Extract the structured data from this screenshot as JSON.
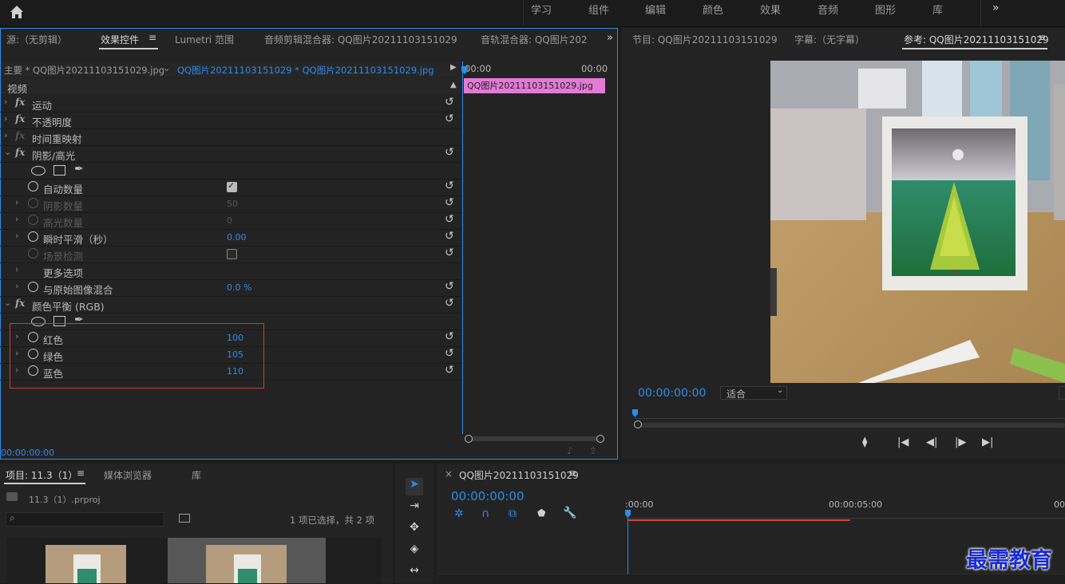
{
  "workspaces": [
    "学习",
    "组件",
    "编辑",
    "颜色",
    "效果",
    "音频",
    "图形",
    "库"
  ],
  "effect_panel": {
    "tabs": [
      "源:（无剪辑）",
      "效果控件",
      "Lumetri 范围",
      "音频剪辑混合器: QQ图片20211103151029",
      "音轨混合器: QQ图片202"
    ],
    "master": "主要 * QQ图片20211103151029.jpg",
    "clip": "QQ图片20211103151029 * QQ图片20211103151029.jpg",
    "video_header": "视频",
    "time_start": "00:00",
    "time_end": "00:00",
    "clip_bar": "QQ图片20211103151029.jpg",
    "timecode": "00:00:00:00",
    "rows": {
      "motion": "运动",
      "opacity": "不透明度",
      "time_remap": "时间重映射",
      "shadow_highlight": "阴影/高光",
      "auto_amount": "自动数量",
      "shadow_amount": "阴影数量",
      "shadow_amount_val": "50",
      "highlight_amount": "高光数量",
      "highlight_amount_val": "0",
      "temporal_smooth": "瞬时平滑（秒）",
      "temporal_smooth_val": "0.00",
      "scene_detect": "场景检测",
      "more_options": "更多选项",
      "blend_original": "与原始图像混合",
      "blend_original_val": "0.0 %",
      "color_balance": "颜色平衡 (RGB)",
      "red": "红色",
      "red_val": "100",
      "green": "绿色",
      "green_val": "105",
      "blue": "蓝色",
      "blue_val": "110"
    }
  },
  "monitor": {
    "tabs": [
      "节目: QQ图片20211103151029",
      "字幕:（无字幕）",
      "参考: QQ图片20211103151029"
    ],
    "timecode": "00:00:00:00",
    "fit": "适合"
  },
  "project": {
    "tabs": [
      "项目: 11.3（1）",
      "媒体浏览器",
      "库"
    ],
    "file": "11.3（1）.prproj",
    "selection": "1 项已选择，共 2 项"
  },
  "timeline": {
    "close": "×",
    "seq": "QQ图片20211103151029",
    "timecode": "00:00:00:00",
    "ruler": [
      ":00:00",
      "00:00:05:00",
      "00:"
    ]
  },
  "watermark": "最需教育"
}
